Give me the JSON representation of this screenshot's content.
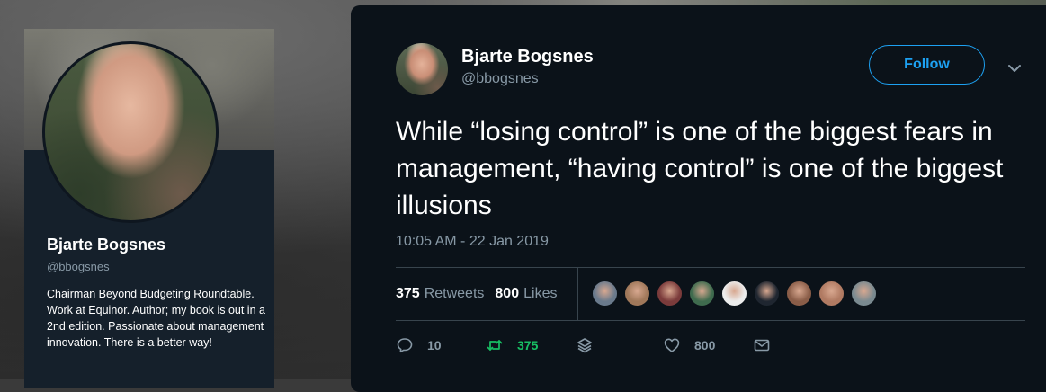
{
  "profile_card": {
    "name": "Bjarte Bogsnes",
    "handle": "@bbogsnes",
    "bio": "Chairman Beyond Budgeting Roundtable. Work at Equinor. Author; my book is out in a 2nd edition. Passionate about management innovation. There is a better way!"
  },
  "tweet": {
    "author_name": "Bjarte Bogsnes",
    "author_handle": "@bbogsnes",
    "follow_label": "Follow",
    "text": "While “losing control” is one of the biggest fears in management, “having control” is one of the biggest illusions",
    "timestamp": "10:05 AM - 22 Jan 2019",
    "retweets_count": "375",
    "retweets_label": "Retweets",
    "likes_count": "800",
    "likes_label": "Likes",
    "actions": {
      "reply_count": "10",
      "retweet_count": "375",
      "like_count": "800"
    }
  },
  "colors": {
    "accent": "#1da1f2",
    "retweet_green": "#17bf63",
    "background": "#0b1219",
    "muted": "#8899a6"
  },
  "likers": [
    {
      "color": "#6a7a8c"
    },
    {
      "color": "#a0785a"
    },
    {
      "color": "#7b3b3b"
    },
    {
      "color": "#3f6b4e"
    },
    {
      "color": "#ececec"
    },
    {
      "color": "#1f2630"
    },
    {
      "color": "#8a5d48"
    },
    {
      "color": "#b07a62"
    },
    {
      "color": "#7a8a90"
    }
  ]
}
